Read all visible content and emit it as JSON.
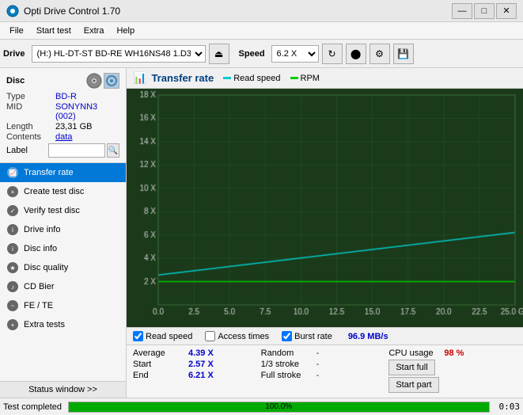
{
  "titlebar": {
    "title": "Opti Drive Control 1.70",
    "minimize": "—",
    "maximize": "□",
    "close": "✕"
  },
  "menubar": {
    "items": [
      "File",
      "Start test",
      "Extra",
      "Help"
    ]
  },
  "toolbar": {
    "drive_label": "Drive",
    "drive_select": "(H:) HL-DT-ST BD-RE  WH16NS48 1.D3",
    "eject_icon": "⏏",
    "speed_label": "Speed",
    "speed_select": "6.2 X",
    "icon1": "↻",
    "icon2": "●",
    "icon3": "◉",
    "icon4": "💾"
  },
  "disc_panel": {
    "title": "Disc",
    "type_key": "Type",
    "type_val": "BD-R",
    "mid_key": "MID",
    "mid_val": "SONYNN3 (002)",
    "length_key": "Length",
    "length_val": "23,31 GB",
    "contents_key": "Contents",
    "contents_val": "data",
    "label_key": "Label",
    "label_val": ""
  },
  "nav": {
    "items": [
      {
        "id": "transfer-rate",
        "label": "Transfer rate",
        "active": true
      },
      {
        "id": "create-test-disc",
        "label": "Create test disc",
        "active": false
      },
      {
        "id": "verify-test-disc",
        "label": "Verify test disc",
        "active": false
      },
      {
        "id": "drive-info",
        "label": "Drive info",
        "active": false
      },
      {
        "id": "disc-info",
        "label": "Disc info",
        "active": false
      },
      {
        "id": "disc-quality",
        "label": "Disc quality",
        "active": false
      },
      {
        "id": "cd-bier",
        "label": "CD Bier",
        "active": false
      },
      {
        "id": "fe-te",
        "label": "FE / TE",
        "active": false
      },
      {
        "id": "extra-tests",
        "label": "Extra tests",
        "active": false
      }
    ],
    "status_window": "Status window >>"
  },
  "chart": {
    "title": "Transfer rate",
    "legend": [
      {
        "label": "Read speed",
        "color": "#00dddd"
      },
      {
        "label": "RPM",
        "color": "#00cc00"
      }
    ],
    "y_axis": [
      "18 X",
      "16 X",
      "14 X",
      "12 X",
      "10 X",
      "8 X",
      "6 X",
      "4 X",
      "2 X"
    ],
    "x_axis": [
      "0.0",
      "2.5",
      "5.0",
      "7.5",
      "10.0",
      "12.5",
      "15.0",
      "17.5",
      "20.0",
      "22.5",
      "25.0 GB"
    ],
    "grid_color": "#2a5a2a",
    "bg_color": "#1a3a1a"
  },
  "checkboxes": {
    "read_speed": {
      "label": "Read speed",
      "checked": true
    },
    "access_times": {
      "label": "Access times",
      "checked": false
    },
    "burst_rate": {
      "label": "Burst rate",
      "checked": true,
      "value": "96.9 MB/s"
    }
  },
  "stats": {
    "average_key": "Average",
    "average_val": "4.39 X",
    "random_key": "Random",
    "random_val": "-",
    "cpu_key": "CPU usage",
    "cpu_val": "98 %",
    "start_key": "Start",
    "start_val": "2.57 X",
    "stroke1_key": "1/3 stroke",
    "stroke1_val": "-",
    "start_full_label": "Start full",
    "end_key": "End",
    "end_val": "6.21 X",
    "full_stroke_key": "Full stroke",
    "full_stroke_val": "-",
    "start_part_label": "Start part"
  },
  "statusbar": {
    "text": "Test completed",
    "progress": 100,
    "progress_label": "100.0%",
    "timer": "0:03"
  }
}
